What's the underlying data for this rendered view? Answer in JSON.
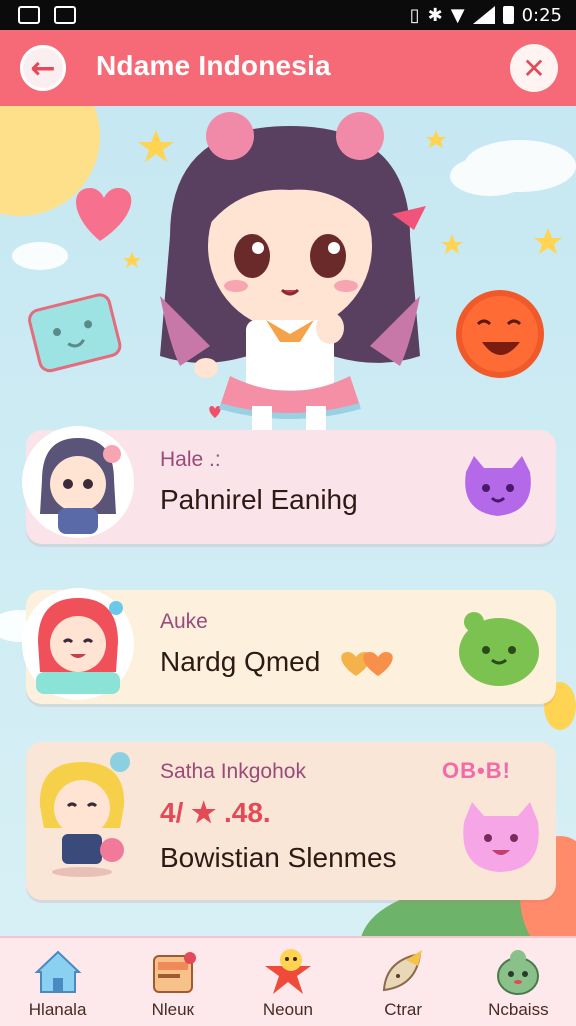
{
  "status_bar": {
    "time": "0:25"
  },
  "header": {
    "title": "Ndame Indonesia"
  },
  "cards": [
    {
      "title": "Hale .:",
      "main": "Pahnirel Eanihg"
    },
    {
      "title": "Auke",
      "main": "Nardg Qmed"
    },
    {
      "title": "Satha Inkgohok",
      "score": "4/ ★ .48.",
      "main": "Bowistian Slenmes",
      "badge": "OB•B!"
    }
  ],
  "nav": [
    {
      "label": "Hlanala",
      "icon": "home-icon"
    },
    {
      "label": "Nleuк",
      "icon": "inbox-icon"
    },
    {
      "label": "Neoun",
      "icon": "star-character-icon"
    },
    {
      "label": "Ctrar",
      "icon": "leaf-icon"
    },
    {
      "label": "Ncbaiss",
      "icon": "creature-icon"
    }
  ],
  "colors": {
    "header": "#f66a77",
    "accent": "#e44957",
    "nav_bg": "#fde8ec"
  }
}
